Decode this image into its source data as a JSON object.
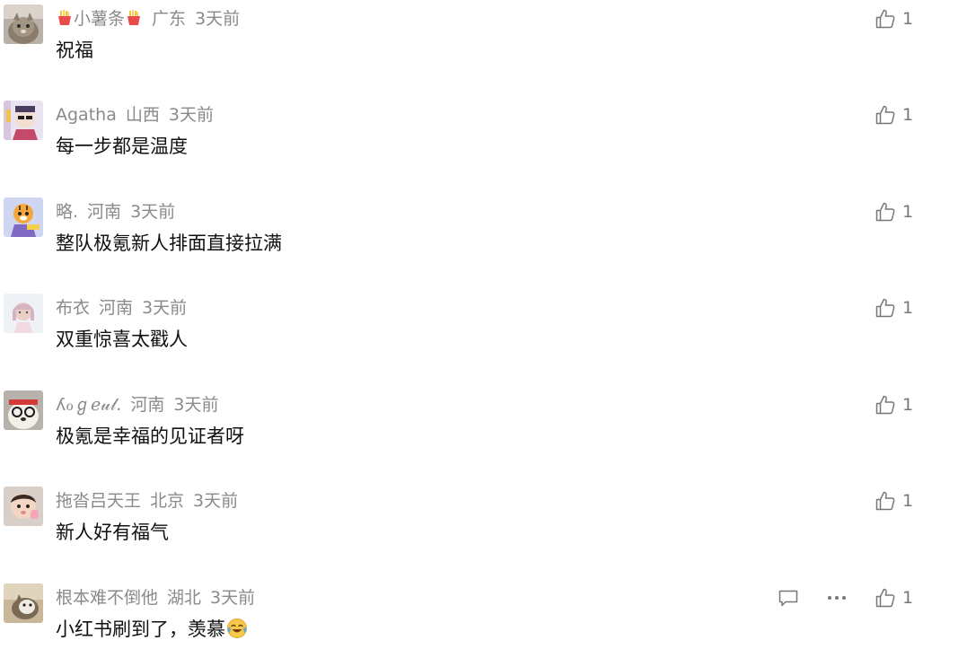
{
  "comments": [
    {
      "user": "小薯条",
      "location": "广东",
      "time": "3天前",
      "text": "祝福",
      "likes": "1",
      "name_decoration": "fries-icon",
      "avatar": "cat-avatar"
    },
    {
      "user": "Agatha",
      "location": "山西",
      "time": "3天前",
      "text": "每一步都是温度",
      "likes": "1",
      "avatar": "character-avatar"
    },
    {
      "user": "略.",
      "location": "河南",
      "time": "3天前",
      "text": "整队极氪新人排面直接拉满",
      "likes": "1",
      "avatar": "tiger-avatar"
    },
    {
      "user": "布衣",
      "location": "河南",
      "time": "3天前",
      "text": "双重惊喜太戳人",
      "likes": "1",
      "avatar": "girl-avatar"
    },
    {
      "user": "ʎℴℊℯ𝓊𝓁.",
      "location": "河南",
      "time": "3天前",
      "text": "极氪是幸福的见证者呀",
      "likes": "1",
      "avatar": "dog-avatar"
    },
    {
      "user": "拖沓吕天王",
      "location": "北京",
      "time": "3天前",
      "text": "新人好有福气",
      "likes": "1",
      "avatar": "baby-avatar"
    },
    {
      "user": "根本难不倒他",
      "location": "湖北",
      "time": "3天前",
      "text": "小红书刷到了，羡慕",
      "likes": "1",
      "avatar": "cat-avatar-2",
      "text_emoji": "laughing-crying-emoji",
      "actions": [
        "reply-icon",
        "more-icon"
      ]
    }
  ],
  "colors": {
    "meta": "#8a8a8a",
    "text": "#111111",
    "icon": "#777777",
    "background": "#ffffff"
  }
}
